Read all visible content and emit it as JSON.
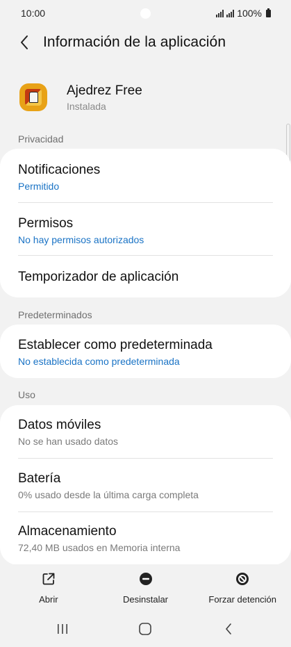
{
  "status_bar": {
    "time": "10:00",
    "battery": "100%"
  },
  "header": {
    "title": "Información de la aplicación"
  },
  "app": {
    "name": "Ajedrez Free",
    "status": "Instalada"
  },
  "sections": {
    "privacy": {
      "label": "Privacidad",
      "items": [
        {
          "title": "Notificaciones",
          "subtitle": "Permitido"
        },
        {
          "title": "Permisos",
          "subtitle": "No hay permisos autorizados"
        },
        {
          "title": "Temporizador de aplicación"
        }
      ]
    },
    "defaults": {
      "label": "Predeterminados",
      "items": [
        {
          "title": "Establecer como predeterminada",
          "subtitle": "No establecida como predeterminada"
        }
      ]
    },
    "usage": {
      "label": "Uso",
      "items": [
        {
          "title": "Datos móviles",
          "subtitle": "No se han usado datos"
        },
        {
          "title": "Batería",
          "subtitle": "0% usado desde la última carga completa"
        },
        {
          "title": "Almacenamiento",
          "subtitle": "72,40 MB usados en Memoria interna"
        }
      ]
    }
  },
  "actions": {
    "open": "Abrir",
    "uninstall": "Desinstalar",
    "force_stop": "Forzar detención"
  },
  "colors": {
    "accent": "#1a73c5",
    "background": "#f2f2f2",
    "card": "#ffffff"
  }
}
